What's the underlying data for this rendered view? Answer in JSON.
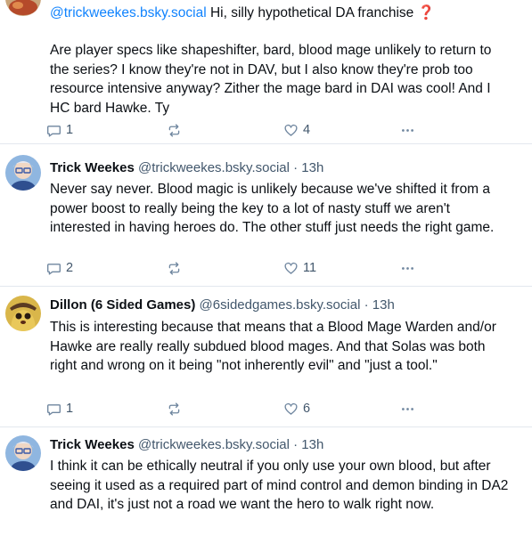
{
  "posts": [
    {
      "author": "",
      "handle": "",
      "time": "",
      "mention": "@trickweekes.bsky.social",
      "text_after_mention": " Hi, silly hypothetical DA franchise ❓",
      "paragraph2": "Are player specs like shapeshifter, bard, blood mage unlikely to return to the series? I know they're not in DAV, but I also know they're prob too resource intensive anyway? Zither the mage bard in DAI was cool! And I HC bard Hawke. Ty",
      "replies": "1",
      "reposts": "",
      "likes": "4"
    },
    {
      "author": "Trick Weekes",
      "handle": "@trickweekes.bsky.social",
      "time": "· 13h",
      "text": "Never say never. Blood magic is unlikely because we've shifted it from a power boost to really being the key to a lot of nasty stuff we aren't interested in having heroes do. The other stuff just needs the right game.",
      "replies": "2",
      "reposts": "",
      "likes": "11"
    },
    {
      "author": "Dillon (6 Sided Games)",
      "handle": "@6sidedgames.bsky.social",
      "time": "· 13h",
      "text": "This is interesting because that means that a Blood Mage Warden and/or Hawke are really really subdued blood mages. And that Solas was both right and wrong on it being \"not inherently evil\" and \"just a tool.\"",
      "replies": "1",
      "reposts": "",
      "likes": "6"
    },
    {
      "author": "Trick Weekes",
      "handle": "@trickweekes.bsky.social",
      "time": "· 13h",
      "text": "I think it can be ethically neutral if you only use your own blood, but after seeing it used as a required part of mind control and demon binding in DA2 and DAI, it's just not a road we want the hero to walk right now."
    }
  ],
  "icons": {
    "reply": "reply-bubble-icon",
    "repost": "repost-arrows-icon",
    "like": "heart-icon",
    "more": "more-dots-icon"
  },
  "colors": {
    "mention": "#1083fe",
    "muted": "#42576c",
    "divider": "#e3e8ee"
  }
}
